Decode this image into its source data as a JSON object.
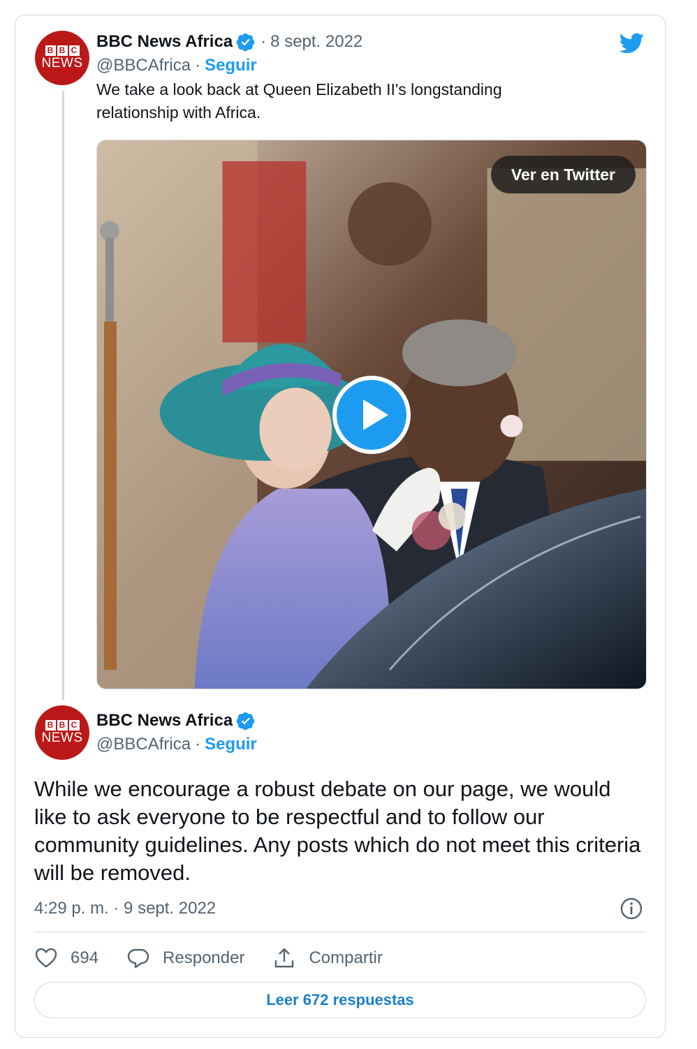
{
  "quoted_tweet": {
    "display_name": "BBC News Africa",
    "handle": "@BBCAfrica",
    "separator": "·",
    "follow_label": "Seguir",
    "date": "8 sept. 2022",
    "text": "We take a look back at Queen Elizabeth II's longstanding relationship with Africa.",
    "media": {
      "view_on_twitter_label": "Ver en Twitter",
      "type": "video"
    }
  },
  "reply_tweet": {
    "display_name": "BBC News Africa",
    "handle": "@BBCAfrica",
    "separator": "·",
    "follow_label": "Seguir",
    "text": "While we encourage a robust debate on our page, we would like to ask everyone to be respectful and to follow our community guidelines. Any posts which do not meet this criteria will be removed.",
    "timestamp": "4:29 p. m. · 9 sept. 2022"
  },
  "avatar": {
    "letters": [
      "B",
      "B",
      "C"
    ],
    "word": "NEWS"
  },
  "actions": {
    "likes": "694",
    "reply_label": "Responder",
    "share_label": "Compartir"
  },
  "read_replies_label": "Leer 672 respuestas",
  "icons": {
    "brand": "twitter-bird-icon",
    "verified": "verified-badge-icon",
    "info": "info-icon",
    "like": "heart-icon",
    "reply": "reply-bubble-icon",
    "share": "share-icon",
    "play": "play-icon"
  },
  "colors": {
    "twitter_blue": "#1d9bf0",
    "bbc_red": "#bb1919",
    "text_primary": "#0f1419",
    "text_secondary": "#536471",
    "border": "#cfd9de"
  }
}
